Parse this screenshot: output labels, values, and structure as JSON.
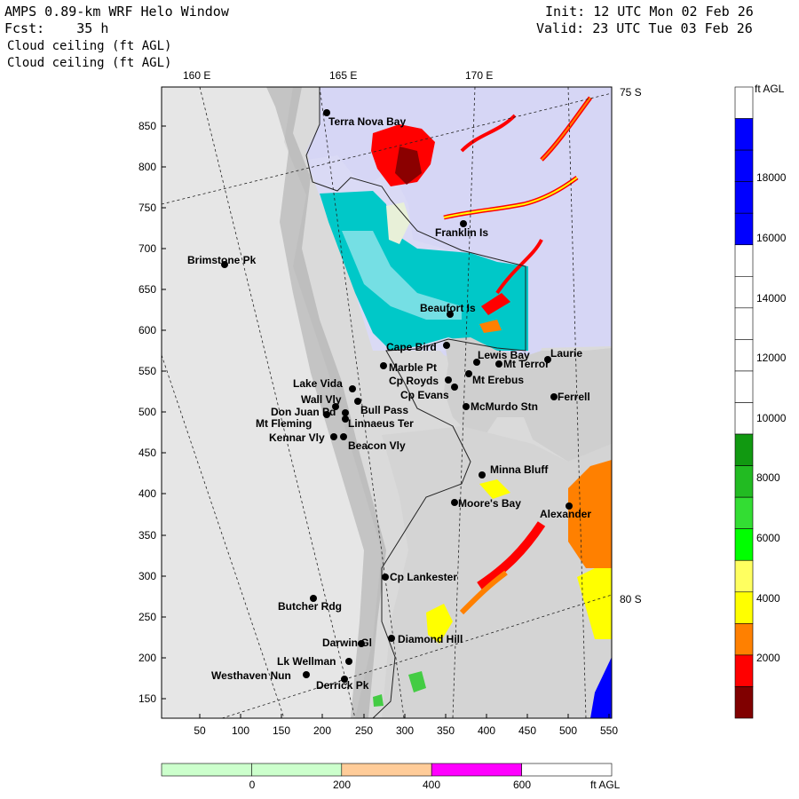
{
  "header": {
    "title": "AMPS 0.89-km WRF Helo Window",
    "fcst_label": "Fcst:",
    "fcst_value": "35 h",
    "field_1": "Cloud ceiling (ft AGL)",
    "field_2": "Cloud ceiling (ft AGL)",
    "init_label": "Init:",
    "init_value": "12 UTC Mon 02 Feb 26",
    "valid_label": "Valid:",
    "valid_value": "23 UTC Tue 03 Feb 26"
  },
  "map": {
    "x_ticks": [
      "50",
      "100",
      "150",
      "200",
      "250",
      "300",
      "350",
      "400",
      "450",
      "500",
      "550"
    ],
    "y_ticks": [
      "850",
      "800",
      "750",
      "700",
      "650",
      "600",
      "550",
      "500",
      "450",
      "400",
      "350",
      "300",
      "250",
      "200",
      "150"
    ],
    "longitude_labels": [
      "160 E",
      "165 E",
      "170 E"
    ],
    "latitude_labels": [
      "75 S",
      "80 S"
    ],
    "stations": [
      {
        "name": "Terra Nova Bay"
      },
      {
        "name": "Franklin Is"
      },
      {
        "name": "Brimstone Pk"
      },
      {
        "name": "Beaufort Is"
      },
      {
        "name": "Cape Bird"
      },
      {
        "name": "Lewis Bay"
      },
      {
        "name": "Laurie"
      },
      {
        "name": "Mt Terror"
      },
      {
        "name": "Marble Pt"
      },
      {
        "name": "Cp Royds"
      },
      {
        "name": "Mt Erebus"
      },
      {
        "name": "Lake Vida"
      },
      {
        "name": "Cp Evans"
      },
      {
        "name": "Ferrell"
      },
      {
        "name": "Wall Vly"
      },
      {
        "name": "Bull Pass"
      },
      {
        "name": "McMurdo Stn"
      },
      {
        "name": "Don Juan Pd"
      },
      {
        "name": "Mt Fleming"
      },
      {
        "name": "Linnaeus Ter"
      },
      {
        "name": "Kennar Vly"
      },
      {
        "name": "Beacon Vly"
      },
      {
        "name": "Minna Bluff"
      },
      {
        "name": "Moore's Bay"
      },
      {
        "name": "Alexander"
      },
      {
        "name": "Cp Lankester"
      },
      {
        "name": "Butcher Rdg"
      },
      {
        "name": "Darwin Gl"
      },
      {
        "name": "Diamond Hill"
      },
      {
        "name": "Lk Wellman"
      },
      {
        "name": "Westhaven Nun"
      },
      {
        "name": "Derrick Pk"
      }
    ]
  },
  "right_colorbar": {
    "unit": "ft AGL",
    "labels": [
      "18000",
      "16000",
      "14000",
      "12000",
      "10000",
      "8000",
      "6000",
      "4000",
      "2000"
    ],
    "colors": [
      "#800000",
      "#ff0000",
      "#ff8000",
      "#ffff00",
      "#ffff60",
      "#00ff00",
      "#33dd33",
      "#22bb22",
      "#119911",
      "#ffffff",
      "#ffffff",
      "#ffffff",
      "#ffffff",
      "#ffffff",
      "#ffffff",
      "#0000ff",
      "#0000ff",
      "#0000ff",
      "#0000ff",
      "#ffffff"
    ]
  },
  "bottom_colorbar": {
    "unit": "ft AGL",
    "labels": [
      "0",
      "200",
      "400",
      "600"
    ],
    "colors": [
      "#ccffcc",
      "#ccffcc",
      "#ffcc99",
      "#ff00ff",
      "#ffffff"
    ]
  },
  "colors": {
    "ocean_lavender": "#d6d6f5",
    "cyan": "#00c8c8",
    "land_gray": "#d8d8d8",
    "red": "#ff0000",
    "dark_red": "#8b0000",
    "orange": "#ff8000",
    "yellow": "#ffff00",
    "blue": "#0000ff"
  }
}
